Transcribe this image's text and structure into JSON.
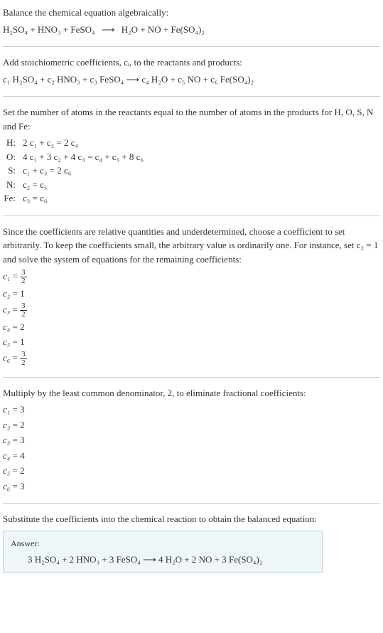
{
  "intro": {
    "line1": "Balance the chemical equation algebraically:",
    "eq_left": "H₂SO₄ + HNO₃ + FeSO₄",
    "eq_arrow": "⟶",
    "eq_right": "H₂O + NO + Fe(SO₄)₂"
  },
  "stoich": {
    "text": "Add stoichiometric coefficients, cᵢ, to the reactants and products:",
    "eq": "c₁ H₂SO₄ + c₂ HNO₃ + c₃ FeSO₄  ⟶  c₄ H₂O + c₅ NO + c₆ Fe(SO₄)₂"
  },
  "atoms": {
    "text": "Set the number of atoms in the reactants equal to the number of atoms in the products for H, O, S, N and Fe:",
    "rows": [
      {
        "label": "H:",
        "eq": "2 c₁ + c₂ = 2 c₄"
      },
      {
        "label": "O:",
        "eq": "4 c₁ + 3 c₂ + 4 c₃ = c₄ + c₅ + 8 c₆"
      },
      {
        "label": "S:",
        "eq": "c₁ + c₃ = 2 c₆"
      },
      {
        "label": "N:",
        "eq": "c₂ = c₅"
      },
      {
        "label": "Fe:",
        "eq": "c₃ = c₆"
      }
    ]
  },
  "relative": {
    "text": "Since the coefficients are relative quantities and underdetermined, choose a coefficient to set arbitrarily. To keep the coefficients small, the arbitrary value is ordinarily one. For instance, set c₂ = 1 and solve the system of equations for the remaining coefficients:",
    "coefs": [
      {
        "var": "c₁",
        "num": "3",
        "den": "2",
        "frac": true
      },
      {
        "var": "c₂",
        "val": "1",
        "frac": false
      },
      {
        "var": "c₃",
        "num": "3",
        "den": "2",
        "frac": true
      },
      {
        "var": "c₄",
        "val": "2",
        "frac": false
      },
      {
        "var": "c₅",
        "val": "1",
        "frac": false
      },
      {
        "var": "c₆",
        "num": "3",
        "den": "2",
        "frac": true
      }
    ]
  },
  "multiply": {
    "text": "Multiply by the least common denominator, 2, to eliminate fractional coefficients:",
    "coefs": [
      {
        "var": "c₁",
        "val": "3"
      },
      {
        "var": "c₂",
        "val": "2"
      },
      {
        "var": "c₃",
        "val": "3"
      },
      {
        "var": "c₄",
        "val": "4"
      },
      {
        "var": "c₅",
        "val": "2"
      },
      {
        "var": "c₆",
        "val": "3"
      }
    ]
  },
  "substitute": {
    "text": "Substitute the coefficients into the chemical reaction to obtain the balanced equation:"
  },
  "answer": {
    "label": "Answer:",
    "eq": "3 H₂SO₄ + 2 HNO₃ + 3 FeSO₄  ⟶  4 H₂O + 2 NO + 3 Fe(SO₄)₂"
  }
}
